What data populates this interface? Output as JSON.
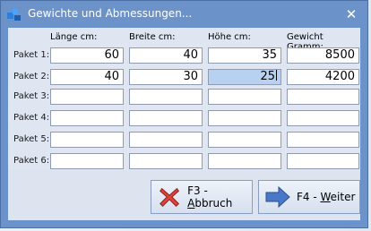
{
  "window": {
    "title": "Gewichte und Abmessungen...",
    "close_glyph": "✕"
  },
  "columns": [
    "Länge cm:",
    "Breite cm:",
    "Höhe cm:",
    "Gewicht Gramm:"
  ],
  "rows": [
    {
      "label": "Paket 1:",
      "values": [
        "60",
        "40",
        "35",
        "8500"
      ]
    },
    {
      "label": "Paket 2:",
      "values": [
        "40",
        "30",
        "25",
        "4200"
      ]
    },
    {
      "label": "Paket 3:",
      "values": [
        "",
        "",
        "",
        ""
      ]
    },
    {
      "label": "Paket 4:",
      "values": [
        "",
        "",
        "",
        ""
      ]
    },
    {
      "label": "Paket 5:",
      "values": [
        "",
        "",
        "",
        ""
      ]
    },
    {
      "label": "Paket 6:",
      "values": [
        "",
        "",
        "",
        ""
      ]
    }
  ],
  "selected_cell": {
    "row": 1,
    "col": 2
  },
  "buttons": {
    "cancel": {
      "prefix": "F3 - ",
      "underlined": "A",
      "rest": "bbruch",
      "icon": "red-x-icon"
    },
    "next": {
      "prefix": "F4 - ",
      "underlined": "W",
      "rest": "eiter",
      "icon": "right-arrow-icon"
    }
  },
  "colors": {
    "titlebar": "#6b93c9",
    "client": "#dfe6f1",
    "selection": "#b9d1f0"
  }
}
